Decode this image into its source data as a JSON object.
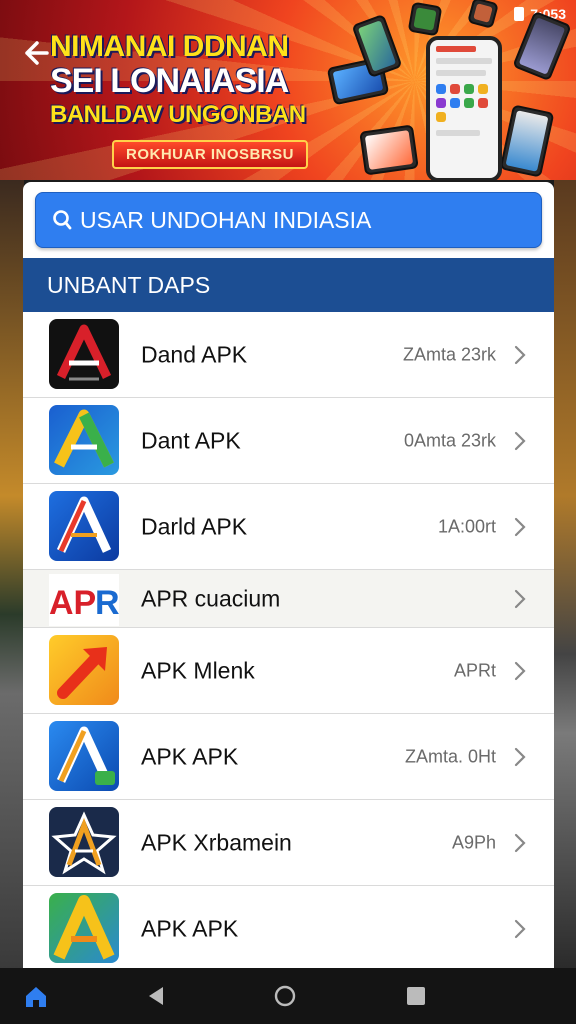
{
  "status_bar": {
    "time": "7:053"
  },
  "banner": {
    "line1": "NIMANAI DDNAN",
    "line2": "SEI LONAIASIA",
    "line3": "BANLDAV UNGONBAN",
    "promo": "ROKHUAR INOSBRSU"
  },
  "search": {
    "placeholder": "USAR UNDOHAN INDIASIA"
  },
  "section": {
    "title": "UNBANT DAPS"
  },
  "apps": [
    {
      "name": "Dand APK",
      "meta": "ZAmta 23rk",
      "icon": "dark-a-icon"
    },
    {
      "name": "Dant APK",
      "meta": "0Amta 23rk",
      "icon": "gradient-a-icon"
    },
    {
      "name": "Darld APK",
      "meta": "1A:00rt",
      "icon": "blue-a-icon"
    },
    {
      "name": "APR cuacium",
      "meta": "",
      "icon": "apr-logo-icon"
    },
    {
      "name": "APK Mlenk",
      "meta": "APRt",
      "icon": "orange-arrow-icon"
    },
    {
      "name": "APK APK",
      "meta": "ZAmta. 0Ht",
      "icon": "blue-a-badge-icon"
    },
    {
      "name": "APK Xrbamein",
      "meta": "A9Ph",
      "icon": "star-a-icon"
    },
    {
      "name": "APK APK",
      "meta": "",
      "icon": "rainbow-a-icon"
    }
  ],
  "colors": {
    "search_bg": "#2f7ef0",
    "section_bg": "#1c4e93",
    "banner_red": "#d42a1c",
    "headline_yellow": "#ffe21a"
  }
}
